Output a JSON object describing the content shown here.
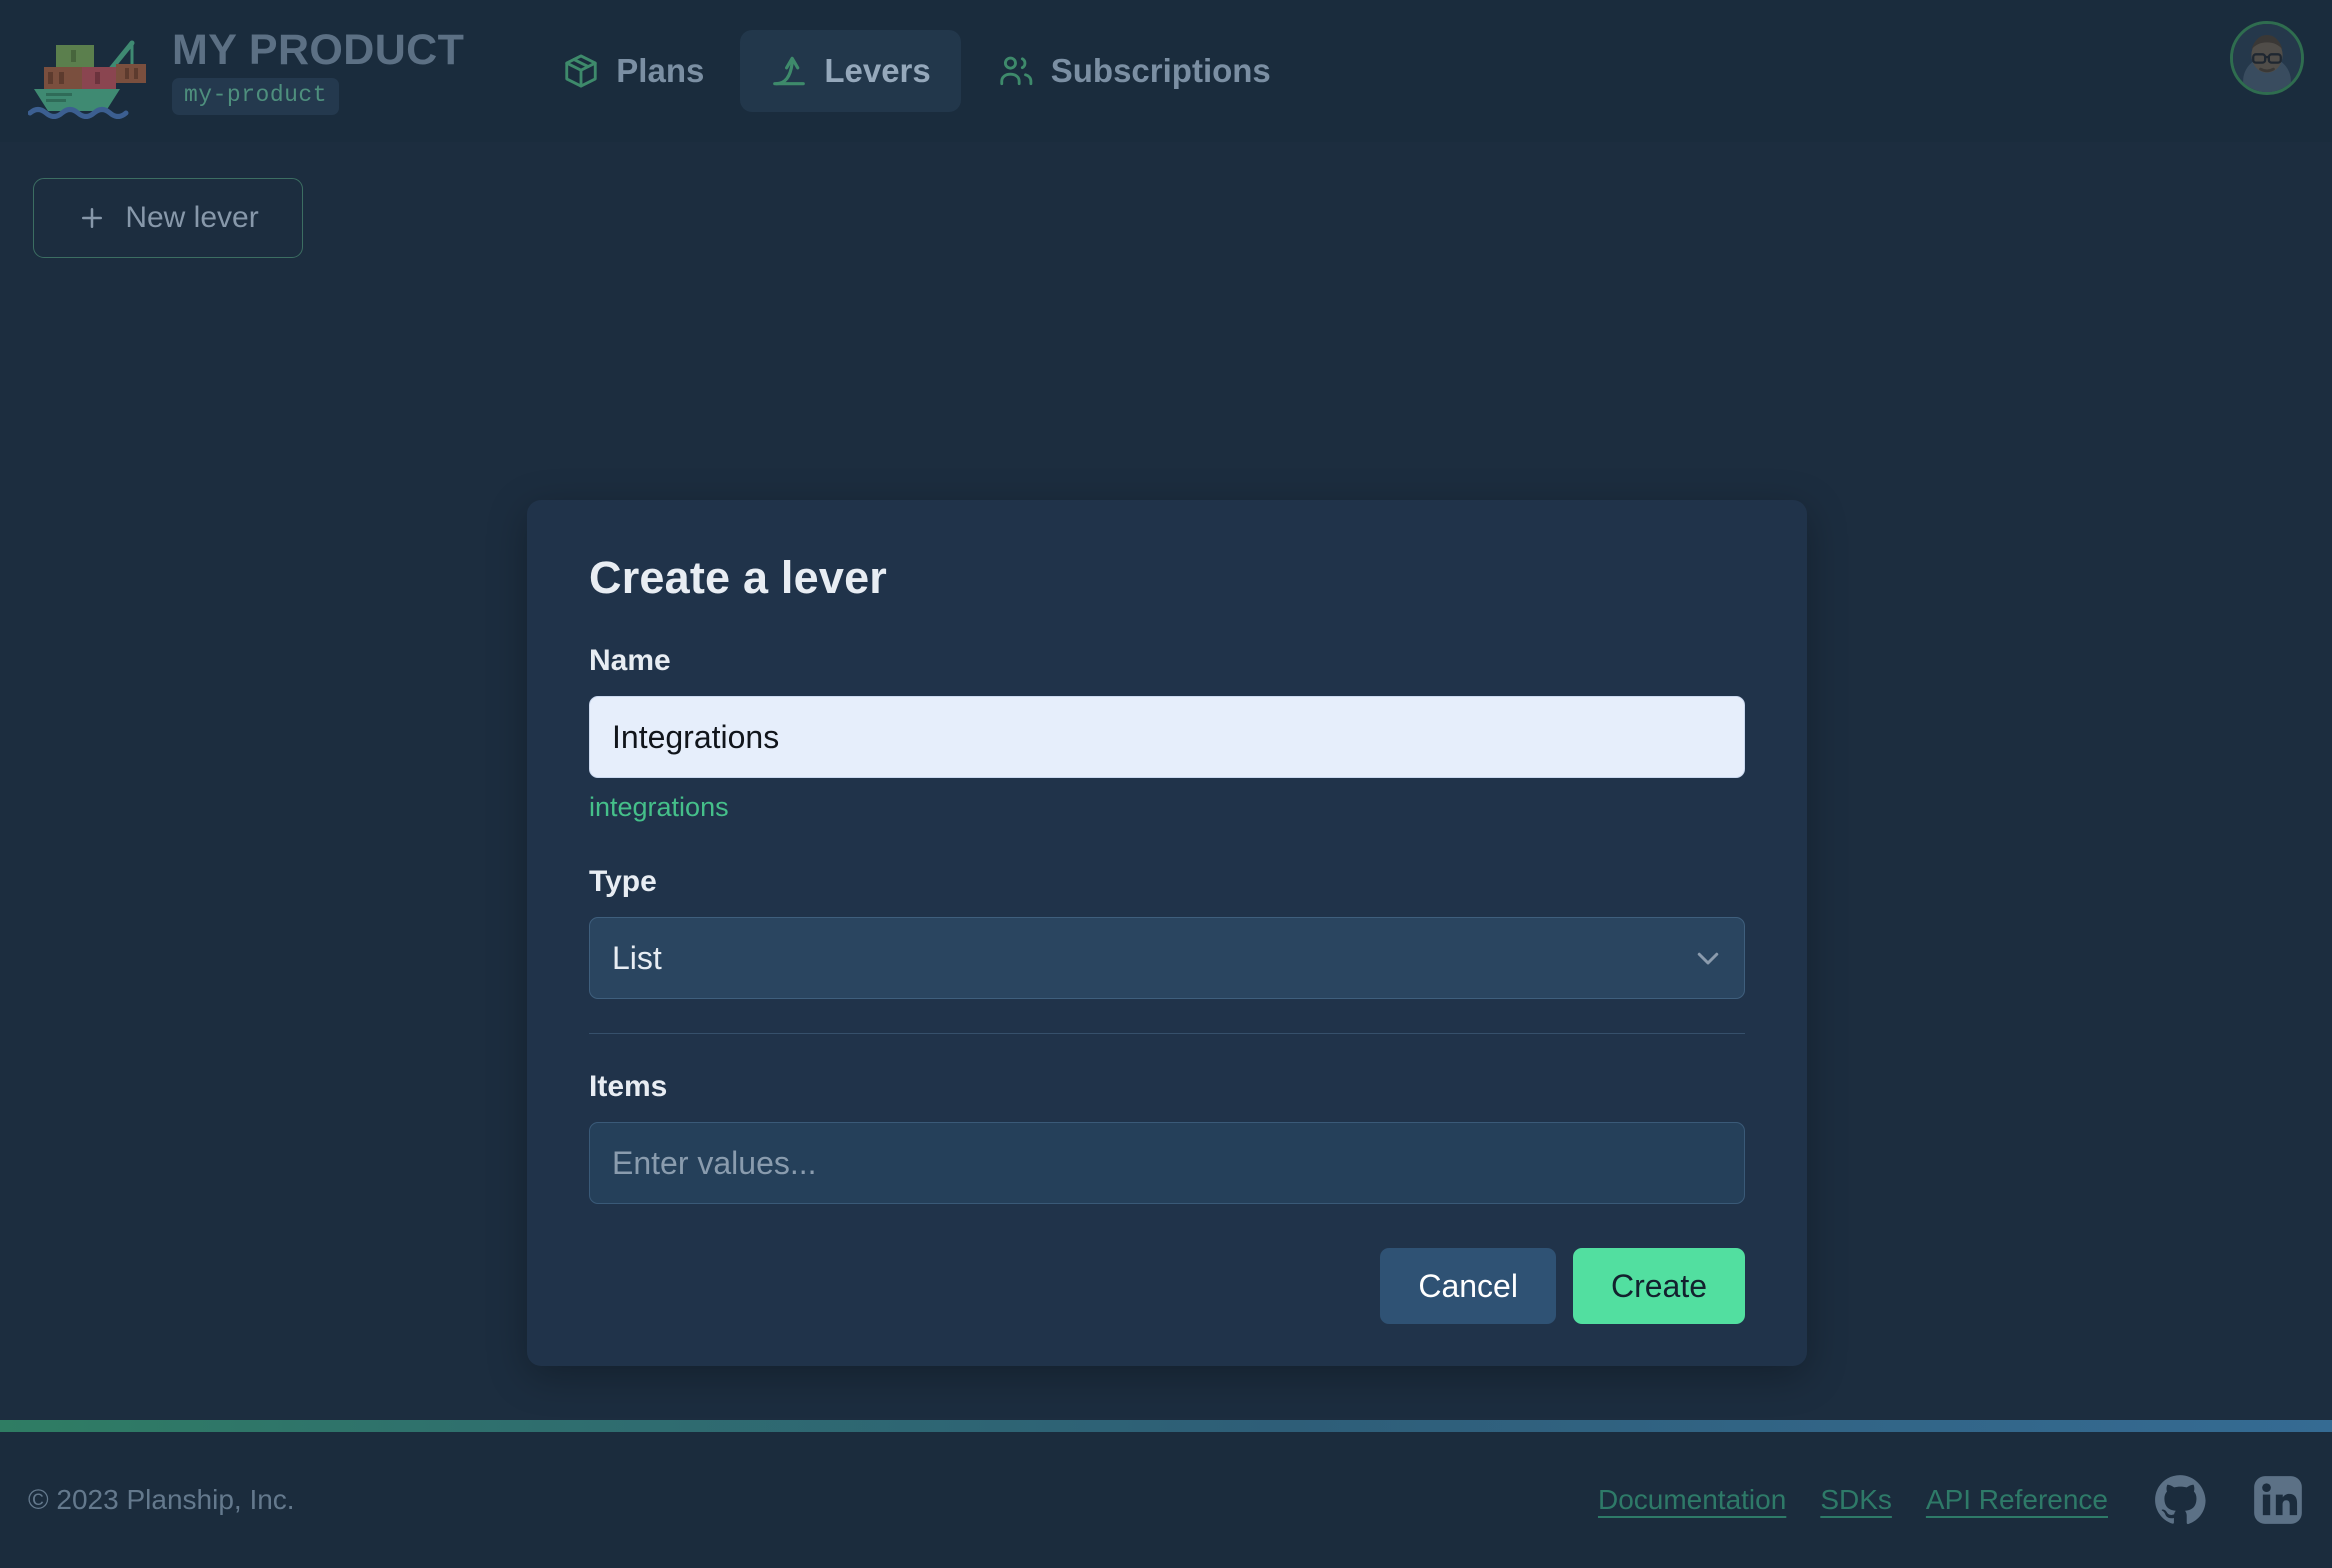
{
  "header": {
    "product_title": "MY PRODUCT",
    "product_slug": "my-product",
    "logo_icon": "cargo-ship-logo",
    "avatar_icon": "user-avatar",
    "nav": [
      {
        "label": "Plans",
        "icon": "package-icon",
        "active": false
      },
      {
        "label": "Levers",
        "icon": "lever-trend-icon",
        "active": true
      },
      {
        "label": "Subscriptions",
        "icon": "users-icon",
        "active": false
      }
    ]
  },
  "toolbar": {
    "new_lever_label": "New lever",
    "plus_icon": "plus-icon"
  },
  "dialog": {
    "title": "Create a lever",
    "name_label": "Name",
    "name_value": "Integrations",
    "name_placeholder": "",
    "slug_hint": "integrations",
    "type_label": "Type",
    "type_value": "List",
    "type_options": [
      "List"
    ],
    "chevron_icon": "chevron-down-icon",
    "items_label": "Items",
    "items_value": "",
    "items_placeholder": "Enter values...",
    "cancel_label": "Cancel",
    "create_label": "Create"
  },
  "footer": {
    "copyright": "© 2023 Planship, Inc.",
    "links": [
      {
        "label": "Documentation"
      },
      {
        "label": "SDKs"
      },
      {
        "label": "API Reference"
      }
    ],
    "social": [
      {
        "icon": "github-icon"
      },
      {
        "icon": "linkedin-icon"
      }
    ]
  },
  "colors": {
    "page_background": "#1c2d3f",
    "dialog_background": "#20334a",
    "accent_green": "#45c08a",
    "create_button": "#52dfa0",
    "cancel_button": "#2f5274",
    "input_light": "#e6eefb",
    "footer_link": "#2e7a68"
  }
}
